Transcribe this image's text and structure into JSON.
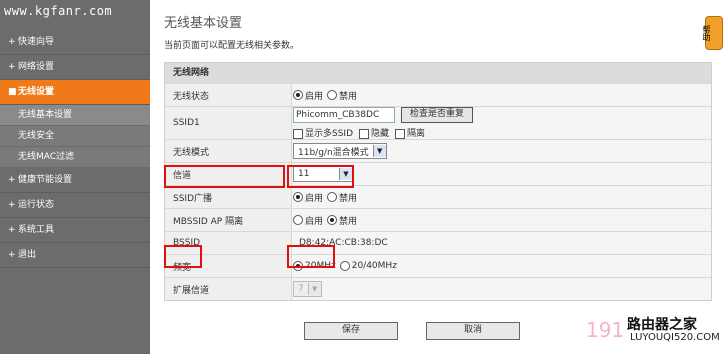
{
  "watermark": "www.kgfanr.com",
  "sidebar": {
    "items": [
      {
        "label": "快速向导"
      },
      {
        "label": "网络设置"
      },
      {
        "label": "无线设置"
      },
      {
        "label": "健康节能设置"
      },
      {
        "label": "运行状态"
      },
      {
        "label": "系统工具"
      },
      {
        "label": "退出"
      }
    ],
    "sub_items": [
      {
        "label": "无线基本设置"
      },
      {
        "label": "无线安全"
      },
      {
        "label": "无线MAC过滤"
      }
    ],
    "bullet": "+",
    "active_bullet": "■"
  },
  "main": {
    "title": "无线基本设置",
    "description": "当前页面可以配置无线相关参数。",
    "panel_title": "无线网络",
    "rows": {
      "wireless_status": {
        "label": "无线状态",
        "on": "启用",
        "off": "禁用"
      },
      "ssid1": {
        "label": "SSID1",
        "value": "Phicomm_CB38DC",
        "check_button": "检查是否重复",
        "show_multi": "显示多SSID",
        "hide": "隐藏",
        "isolate": "隔离"
      },
      "mode": {
        "label": "无线模式",
        "value": "11b/g/n混合模式"
      },
      "channel": {
        "label": "信道",
        "value": "11"
      },
      "ssid_broadcast": {
        "label": "SSID广播",
        "on": "启用",
        "off": "禁用"
      },
      "mbssid": {
        "label": "MBSSID AP 隔离",
        "on": "启用",
        "off": "禁用"
      },
      "bssid": {
        "label": "BSSID",
        "value": "D8:42:AC:CB:38:DC"
      },
      "bandwidth": {
        "label": "频宽",
        "opt1": "20MHz",
        "opt2": "20/40MHz"
      },
      "ext_channel": {
        "label": "扩展信道",
        "value": "7"
      }
    },
    "save_label": "保存",
    "cancel_label": "取消"
  },
  "help_tab": "帮助",
  "brand": {
    "line1": "路由器之家",
    "line2": "LUYOUQI520.COM",
    "line3": "191"
  },
  "colors": {
    "accent": "#f07a1a",
    "highlight": "#e01010",
    "sidebar": "#6c6c6c"
  }
}
